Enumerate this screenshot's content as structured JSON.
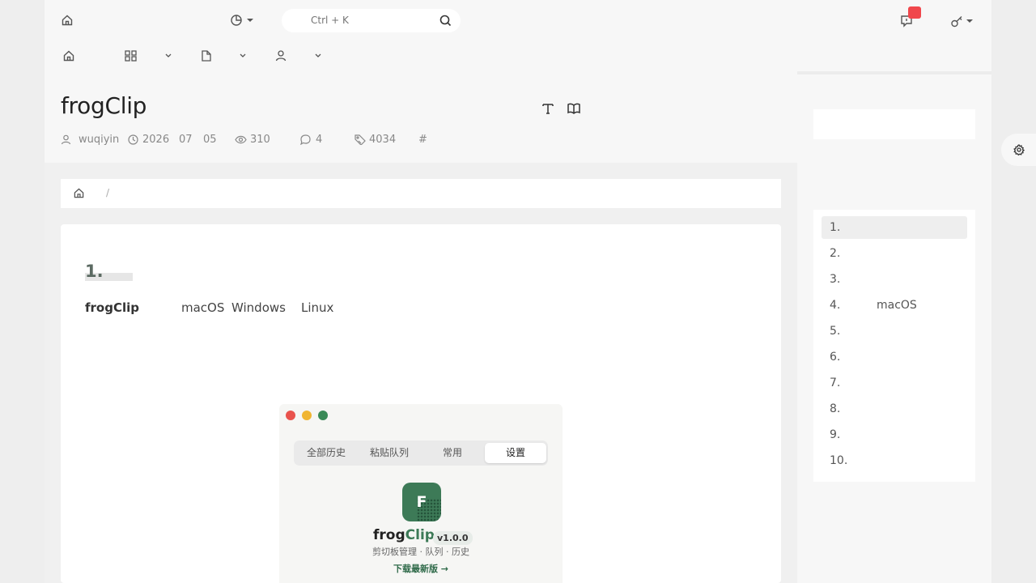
{
  "header": {
    "search_placeholder": "Ctrl + K"
  },
  "article": {
    "title": "frogClip",
    "meta": {
      "author": "wuqiyin",
      "date_year": "2026",
      "date_month": "07",
      "date_day": "05",
      "views": "310",
      "comments": "4",
      "words": "4034",
      "tags_symbol": "#"
    },
    "breadcrumb_separator": "/",
    "heading": "1.",
    "paragraph": {
      "bold": "frogClip",
      "os1": "macOS",
      "os2": "Windows",
      "os3": "Linux"
    }
  },
  "app_screenshot": {
    "tabs": [
      "全部历史",
      "粘贴队列",
      "常用",
      "设置"
    ],
    "active_tab": "设置",
    "icon_letter": "F",
    "app_name_prefix": "frog",
    "app_name_suffix": "Clip",
    "version": "v1.0.0",
    "subtitle": "剪切板管理 · 队列 · 历史",
    "download": "下载最新版 →",
    "colors": {
      "close": "#e9534d",
      "minimize": "#f0b531",
      "zoom": "#3a8a57",
      "brand": "#3d7a57"
    }
  },
  "toc": {
    "items": [
      "1.",
      "2.",
      "3.",
      "4.",
      "5.",
      "6.",
      "7.",
      "8.",
      "9.",
      "10."
    ],
    "item4_extra": "macOS",
    "active_index": 0
  },
  "colors": {
    "notification_badge": "#f0474c",
    "heading": "#5b6a62"
  }
}
